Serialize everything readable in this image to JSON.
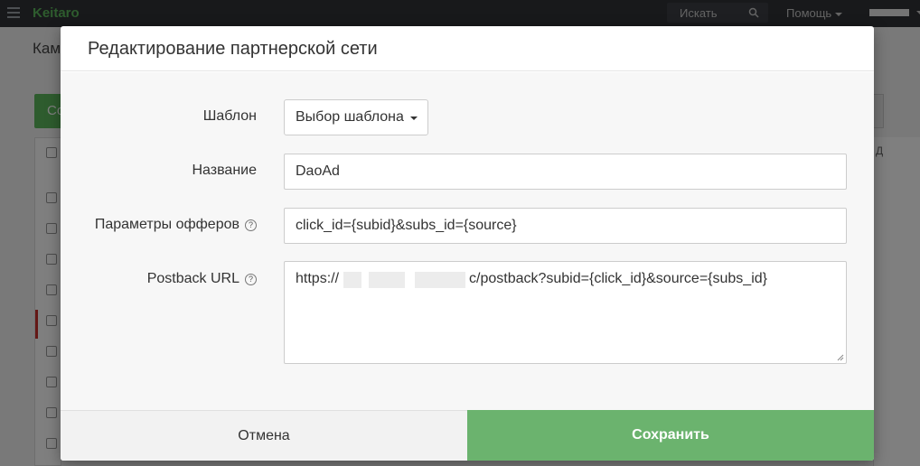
{
  "app": {
    "brand": "Keitaro",
    "search_label": "Искать",
    "help_label": "Помощь",
    "page_title_partial": "Кам",
    "create_button_partial": "Со",
    "column_header_partial": "Д"
  },
  "modal": {
    "title": "Редактирование партнерской сети",
    "fields": {
      "template": {
        "label": "Шаблон",
        "button_label": "Выбор шаблона"
      },
      "name": {
        "label": "Название",
        "value": "DaoAd"
      },
      "offer_params": {
        "label": "Параметры офферов",
        "value": "click_id={subid}&subs_id={source}"
      },
      "postback_url": {
        "label": "Postback URL",
        "value_prefix": "https://",
        "value_suffix": "c/postback?subid={click_id}&source={subs_id}"
      }
    },
    "help_icon_glyph": "?",
    "buttons": {
      "cancel": "Отмена",
      "save": "Сохранить"
    }
  },
  "colors": {
    "accent_green": "#6bb36e",
    "topbar": "#303236",
    "brand_green": "#5cb85c"
  },
  "icons": [
    "menu-icon",
    "search-icon",
    "chevron-down-icon",
    "help-circle-icon",
    "resize-grip-icon"
  ]
}
